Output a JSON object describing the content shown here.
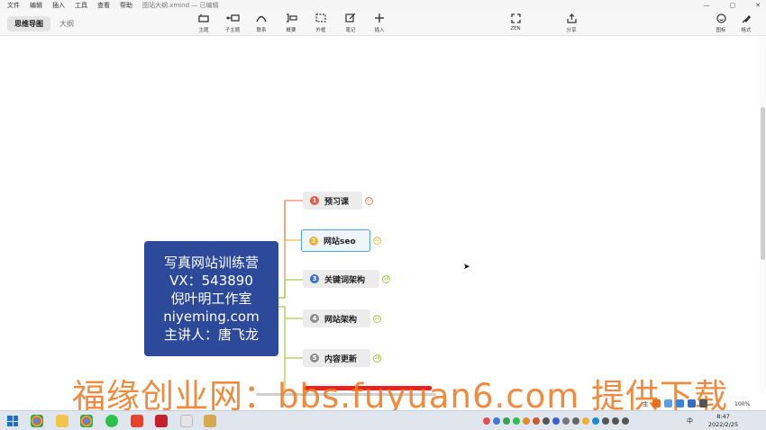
{
  "menu": {
    "items": [
      "文件",
      "编辑",
      "插入",
      "工具",
      "查看",
      "帮助"
    ],
    "doc_title": "图站大纲.xmind — 已编辑"
  },
  "window": {
    "min": "—",
    "max": "▢",
    "close": "✕"
  },
  "view_tabs": {
    "mindmap": "思维导图",
    "outline": "大纲"
  },
  "toolbar": {
    "topic": "主题",
    "subtopic": "子主题",
    "relationship": "联系",
    "summary": "概要",
    "boundary": "外框",
    "note": "笔记",
    "insert": "插入",
    "zen": "ZEN",
    "share": "分享",
    "icon": "图标",
    "format": "格式"
  },
  "central": {
    "lines": [
      "写真网站训练营",
      "VX：543890",
      "倪叶明工作室",
      "niyeming.com",
      "主讲人：唐飞龙"
    ],
    "color": "#2d4a9a"
  },
  "branches": [
    {
      "n": "1",
      "label": "预习课",
      "badge": "14",
      "color": "#e05a47",
      "line": "#ef8a5a"
    },
    {
      "n": "2",
      "label": "网站seo",
      "badge": "11",
      "color": "#f2b02a",
      "line": "#f2c14a"
    },
    {
      "n": "3",
      "label": "关键词架构",
      "badge": "10",
      "color": "#3b6fd0",
      "line": "#a7d14a"
    },
    {
      "n": "4",
      "label": "网站架构",
      "badge": "11",
      "color": "#8e8e8e",
      "line": "#a7d14a"
    },
    {
      "n": "5",
      "label": "内容更新",
      "badge": "28",
      "color": "#8e8e8e",
      "line": "#a7d14a"
    }
  ],
  "watermark": "福缘创业网：bbs.fuyuan6.com  提供下载",
  "status": {
    "label": "主",
    "zoom": "100%"
  },
  "taskbar": {
    "time": "8:47",
    "date": "2022/2/25",
    "lang": "中"
  }
}
